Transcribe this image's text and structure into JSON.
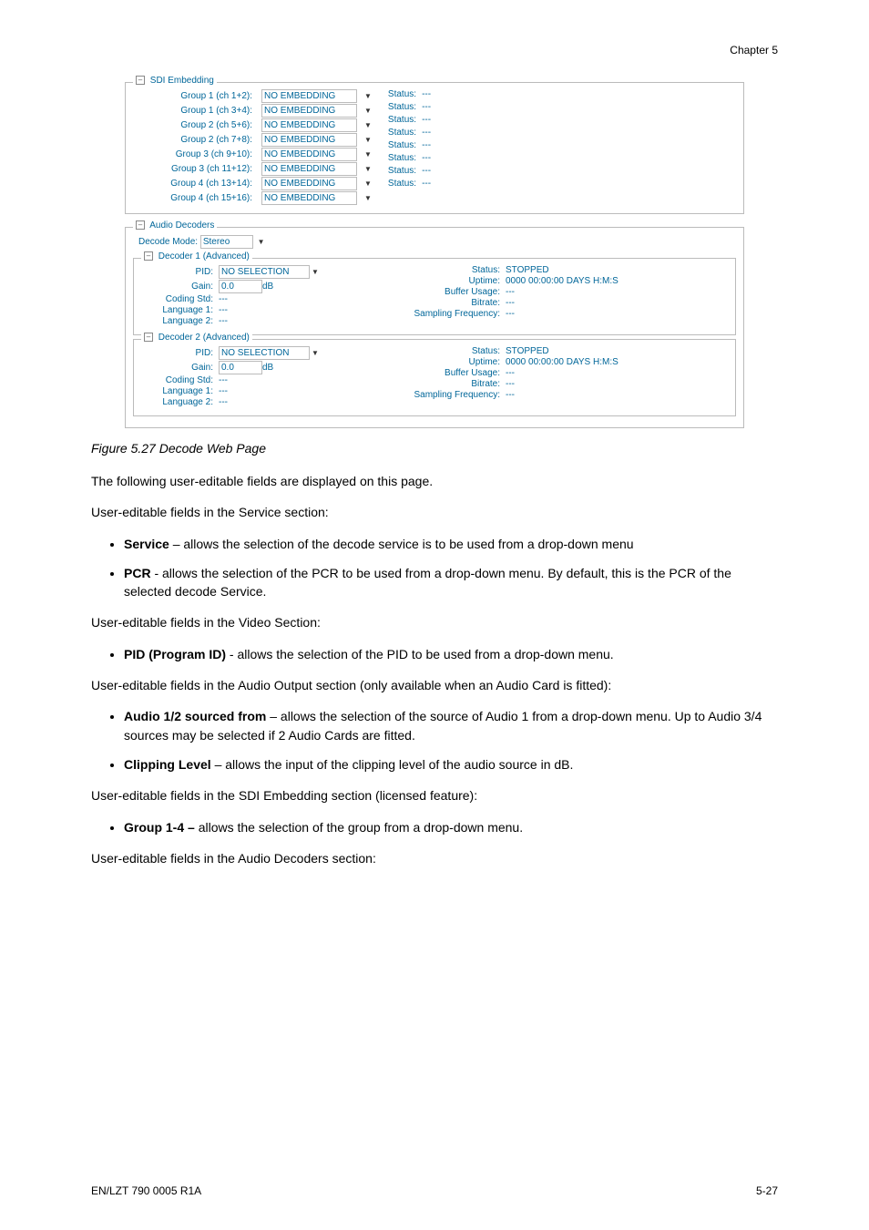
{
  "chapter": "Chapter 5",
  "sdi": {
    "title": "SDI Embedding",
    "sel_value": "NO EMBEDDING",
    "rows": [
      {
        "label": "Group 1 (ch 1+2):"
      },
      {
        "label": "Group 1 (ch 3+4):"
      },
      {
        "label": "Group 2 (ch 5+6):"
      },
      {
        "label": "Group 2 (ch 7+8):"
      },
      {
        "label": "Group 3 (ch 9+10):"
      },
      {
        "label": "Group 3 (ch 11+12):"
      },
      {
        "label": "Group 4 (ch 13+14):"
      },
      {
        "label": "Group 4 (ch 15+16):"
      }
    ],
    "status_label": "Status:",
    "status_value": "---"
  },
  "audio_decoders": {
    "title": "Audio Decoders",
    "mode_label": "Decode Mode:",
    "mode_value": "Stereo"
  },
  "decoder_common": {
    "pid_label": "PID:",
    "pid_value": "NO SELECTION",
    "gain_label": "Gain:",
    "gain_value": "0.0",
    "gain_unit": "dB",
    "coding_label": "Coding Std:",
    "lang1_label": "Language 1:",
    "lang2_label": "Language 2:",
    "dashes": "---",
    "status_label": "Status:",
    "uptime_label": "Uptime:",
    "buffer_label": "Buffer Usage:",
    "bitrate_label": "Bitrate:",
    "sampling_label": "Sampling Frequency:",
    "status_value": "STOPPED",
    "uptime_value": "0000 00:00:00 DAYS H:M:S"
  },
  "decoder1_title": "Decoder 1 (Advanced)",
  "decoder2_title": "Decoder 2 (Advanced)",
  "caption": "Figure 5.27 Decode Web Page",
  "p_intro": "The following user-editable fields are displayed on this page.",
  "p_service_section": "User-editable fields in the Service section:",
  "li_service_b": "Service",
  "li_service_t": " – allows the selection of the decode service is to be used from a drop-down menu",
  "li_pcr_b": "PCR",
  "li_pcr_t": " - allows the selection of the PCR to be used from a drop-down menu. By default, this is the PCR of the selected decode Service.",
  "p_video_section": "User-editable fields in the Video Section:",
  "li_pid_b": "PID (Program ID)",
  "li_pid_t": " - allows the selection of the PID to be used from a drop-down menu.",
  "p_audio_output": "User-editable fields in the Audio Output section (only available when an Audio Card is fitted):",
  "li_audio12_b": "Audio 1/2 sourced from",
  "li_audio12_t": " – allows the selection of the source of Audio 1 from a drop-down menu. Up to Audio 3/4 sources may be selected if 2 Audio Cards are fitted.",
  "li_clip_b": "Clipping Level",
  "li_clip_t": " – allows the input of the clipping level of the audio source in dB.",
  "p_sdi_section": "User-editable fields in the SDI Embedding section (licensed feature):",
  "li_group_b": "Group 1-4 – ",
  "li_group_t": "allows the selection of the group from a drop-down menu.",
  "p_audio_dec_section": "User-editable fields in the Audio Decoders section:",
  "footer_left": "EN/LZT 790 0005 R1A",
  "footer_right": "5-27"
}
